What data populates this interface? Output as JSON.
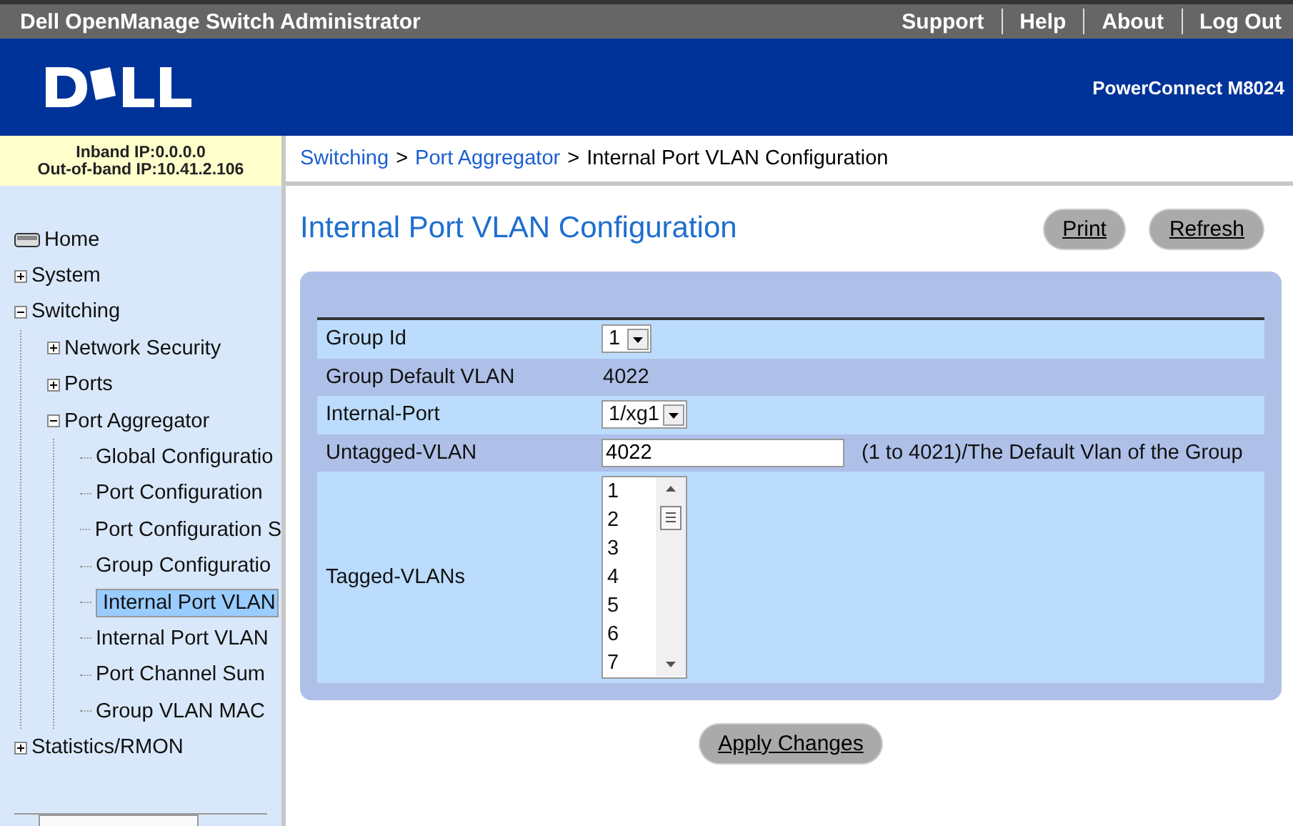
{
  "top_bar": {
    "title": "Dell OpenManage Switch Administrator",
    "links": [
      "Support",
      "Help",
      "About",
      "Log Out"
    ]
  },
  "banner": {
    "product": "PowerConnect M8024"
  },
  "ip_info": [
    "Inband IP:0.0.0.0",
    "Out-of-band IP:10.41.2.106"
  ],
  "breadcrumb": {
    "links": [
      "Switching",
      "Port Aggregator"
    ],
    "separator": ">",
    "current": "Internal Port VLAN Configuration"
  },
  "sidebar": {
    "items": [
      {
        "label": "Home",
        "kind": "home",
        "selected": false
      },
      {
        "label": "System",
        "kind": "folder",
        "expanded": false,
        "selected": false
      },
      {
        "label": "Switching",
        "kind": "folder",
        "expanded": true,
        "selected": false,
        "children": [
          {
            "label": "Network Security",
            "kind": "folder",
            "expanded": false,
            "selected": false
          },
          {
            "label": "Ports",
            "kind": "folder",
            "expanded": false,
            "selected": false
          },
          {
            "label": "Port Aggregator",
            "kind": "folder",
            "expanded": true,
            "selected": false,
            "children": [
              {
                "label": "Global Configuratio",
                "kind": "page",
                "selected": false
              },
              {
                "label": "Port Configuration",
                "kind": "page",
                "selected": false
              },
              {
                "label": "Port Configuration S",
                "kind": "page",
                "selected": false
              },
              {
                "label": "Group Configuratio",
                "kind": "page",
                "selected": false
              },
              {
                "label": "Internal Port VLAN",
                "kind": "page",
                "selected": true
              },
              {
                "label": "Internal Port VLAN",
                "kind": "page",
                "selected": false
              },
              {
                "label": "Port Channel Sum",
                "kind": "page",
                "selected": false
              },
              {
                "label": "Group VLAN MAC",
                "kind": "page",
                "selected": false
              }
            ]
          }
        ]
      },
      {
        "label": "Statistics/RMON",
        "kind": "folder",
        "expanded": false,
        "selected": false
      }
    ]
  },
  "page": {
    "title": "Internal Port VLAN Configuration",
    "buttons": [
      "Print",
      "Refresh"
    ]
  },
  "form": {
    "rows": [
      {
        "label": "Group Id",
        "kind": "select",
        "value": "1"
      },
      {
        "label": "Group Default VLAN",
        "kind": "text",
        "value": "4022"
      },
      {
        "label": "Internal-Port",
        "kind": "select",
        "value": "1/xg1"
      },
      {
        "label": "Untagged-VLAN",
        "kind": "input",
        "value": "4022",
        "hint": "(1 to 4021)/The Default Vlan of the Group"
      },
      {
        "label": "Tagged-VLANs",
        "kind": "listbox",
        "options": [
          "1",
          "2",
          "3",
          "4",
          "5",
          "6",
          "7"
        ]
      }
    ]
  },
  "apply_button": "Apply Changes"
}
